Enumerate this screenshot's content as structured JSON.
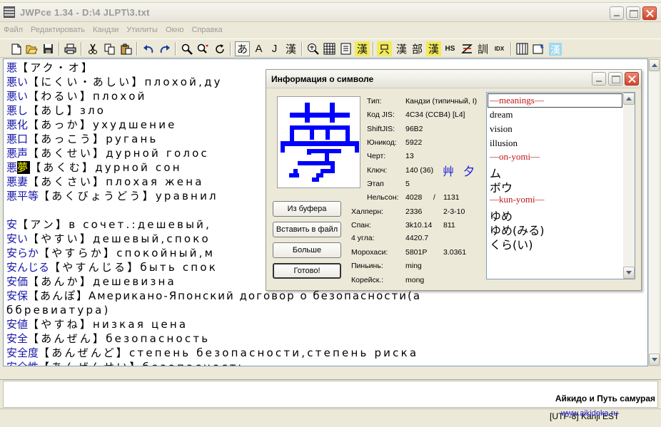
{
  "window": {
    "title": "JWPce 1.34 - D:\\4 JLPT\\3.txt"
  },
  "menu": [
    "Файл",
    "Редактировать",
    "Кандзи",
    "Утилиты",
    "Окно",
    "Справка"
  ],
  "toolbar": {
    "mode_hiragana": "あ",
    "mode_ascii": "A",
    "mode_j": "J",
    "mode_kanji": "漢",
    "kanji_btn": "漢",
    "radical_btn": "部",
    "kanji_btn2": "漢",
    "hs_btn": "HS",
    "train_btn": "訓",
    "idx_btn": "IDX",
    "yellow_btn": "只"
  },
  "editor": {
    "lines": [
      {
        "kanji": "悪",
        "kana": "【アク・オ】",
        "ru": ""
      },
      {
        "kanji": "悪い",
        "kana": "【にくい・あしい】",
        "ru": "плохой,ду"
      },
      {
        "kanji": "悪い",
        "kana": "【わるい】",
        "ru": "плохой"
      },
      {
        "kanji": "悪し",
        "kana": "【あし】",
        "ru": "зло"
      },
      {
        "kanji": "悪化",
        "kana": "【あっか】",
        "ru": "ухудшение"
      },
      {
        "kanji": "悪口",
        "kana": "【あっこう】",
        "ru": "ругань"
      },
      {
        "kanji": "悪声",
        "kana": "【あくせい】",
        "ru": "дурной голос"
      },
      {
        "kanji": "悪",
        "kanji_hl": "夢",
        "kana": "【あくむ】",
        "ru": "дурной сон"
      },
      {
        "kanji": "悪妻",
        "kana": "【あくさい】",
        "ru": "плохая жена"
      },
      {
        "kanji": "悪平等",
        "kana": "【あくびょうどう】",
        "ru": "уравнил"
      },
      {
        "kanji": "",
        "kana": "",
        "ru": ""
      },
      {
        "kanji": "安",
        "kana": "【アン】",
        "ru": "в сочет.:дешевый,"
      },
      {
        "kanji": "安い",
        "kana": "【やすい】",
        "ru": "дешевый,споко"
      },
      {
        "kanji": "安らか",
        "kana": "【やすらか】",
        "ru": "спокойный,м"
      },
      {
        "kanji": "安んじる",
        "kana": "【やすんじる】",
        "ru": "быть спок"
      },
      {
        "kanji": "安価",
        "kana": "【あんか】",
        "ru": "дешевизна"
      },
      {
        "kanji": "安保",
        "kana": "【あんぽ】",
        "ru": "Американо-Японский договор о безопасности(а"
      },
      {
        "kanji": "",
        "kana": "",
        "ru": "ббревиатура)"
      },
      {
        "kanji": "安値",
        "kana": "【やすね】",
        "ru": "низкая цена"
      },
      {
        "kanji": "安全",
        "kana": "【あんぜん】",
        "ru": "безопасность"
      },
      {
        "kanji": "安全度",
        "kana": "【あんぜんど】",
        "ru": "степень безопасности,степень риска"
      },
      {
        "kanji": "安全性",
        "kana": "【あんぜんせい】",
        "ru": "безопасность"
      }
    ]
  },
  "lower": {
    "caption": "Айкидо и Путь самурая"
  },
  "status": {
    "text": "[UTF-8]     Kanji  EST",
    "brand": "www.aikidoka.ru"
  },
  "dialog": {
    "title": "Информация о символе",
    "fields": [
      {
        "label": "Тип:",
        "value": "Кандзи (типичный, I)"
      },
      {
        "label": "Код JIS:",
        "value": "4C34 (CCB4) [L4]"
      },
      {
        "label": "ShiftJIS:",
        "value": "96B2"
      },
      {
        "label": "Юникод:",
        "value": "5922"
      },
      {
        "label": "Черт:",
        "value": "13"
      },
      {
        "label": "Ключ:",
        "value": "140 (36)"
      },
      {
        "label": "Этап",
        "value": "5"
      }
    ],
    "radicals": [
      "艸",
      "夕"
    ],
    "nelson": {
      "label": "Нельсон:",
      "v1": "4028",
      "sep": "/",
      "v2": "1131"
    },
    "lower_fields": [
      {
        "label": "Халперн:",
        "v1": "2336",
        "v2": "2-3-10"
      },
      {
        "label": "Спан:",
        "v1": "3k10.14",
        "v2": "811"
      },
      {
        "label": "4 угла:",
        "v1": "4420.7",
        "v2": ""
      },
      {
        "label": "Морохаси:",
        "v1": "5801P",
        "v2": "3.0361"
      },
      {
        "label": "Пиньинь:",
        "v1": "ming",
        "v2": ""
      },
      {
        "label": "Корейск.:",
        "v1": "mong",
        "v2": ""
      }
    ],
    "buttons": {
      "from_clipboard": "Из буфера",
      "insert_file": "Вставить в файл",
      "more": "Больше",
      "done": "Готово!"
    },
    "meanings_header": "—meanings—",
    "meanings": [
      "dream",
      "vision",
      "illusion"
    ],
    "onyomi_header": "—on-yomi—",
    "onyomi": [
      "ム",
      "ボウ"
    ],
    "kunyomi_header": "—kun-yomi—",
    "kunyomi": [
      "ゆめ",
      "ゆめ(みる)",
      "くら(い)"
    ]
  }
}
